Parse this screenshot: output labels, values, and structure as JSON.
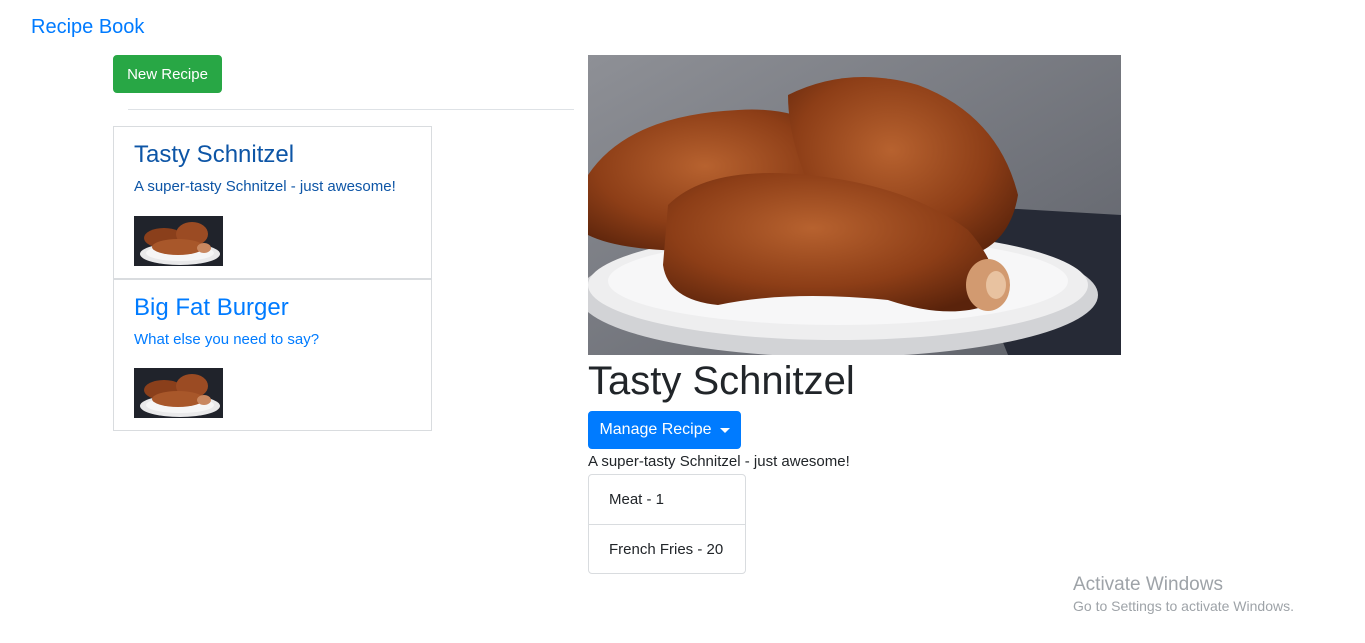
{
  "navbar": {
    "brand": "Recipe Book"
  },
  "actions": {
    "new_recipe_label": "New Recipe"
  },
  "recipes": [
    {
      "name": "Tasty Schnitzel",
      "description": "A super-tasty Schnitzel - just awesome!",
      "active": true
    },
    {
      "name": "Big Fat Burger",
      "description": "What else you need to say?",
      "active": false
    }
  ],
  "detail": {
    "title": "Tasty Schnitzel",
    "manage_label": "Manage Recipe",
    "description": "A super-tasty Schnitzel - just awesome!",
    "ingredients": [
      "Meat - 1",
      "French Fries - 20"
    ]
  },
  "watermark": {
    "title": "Activate Windows",
    "subtitle": "Go to Settings to activate Windows."
  },
  "colors": {
    "primary": "#007bff",
    "success": "#28a745",
    "active_text": "#0d55a6"
  },
  "icons": {
    "dropdown": "caret-down-icon"
  }
}
